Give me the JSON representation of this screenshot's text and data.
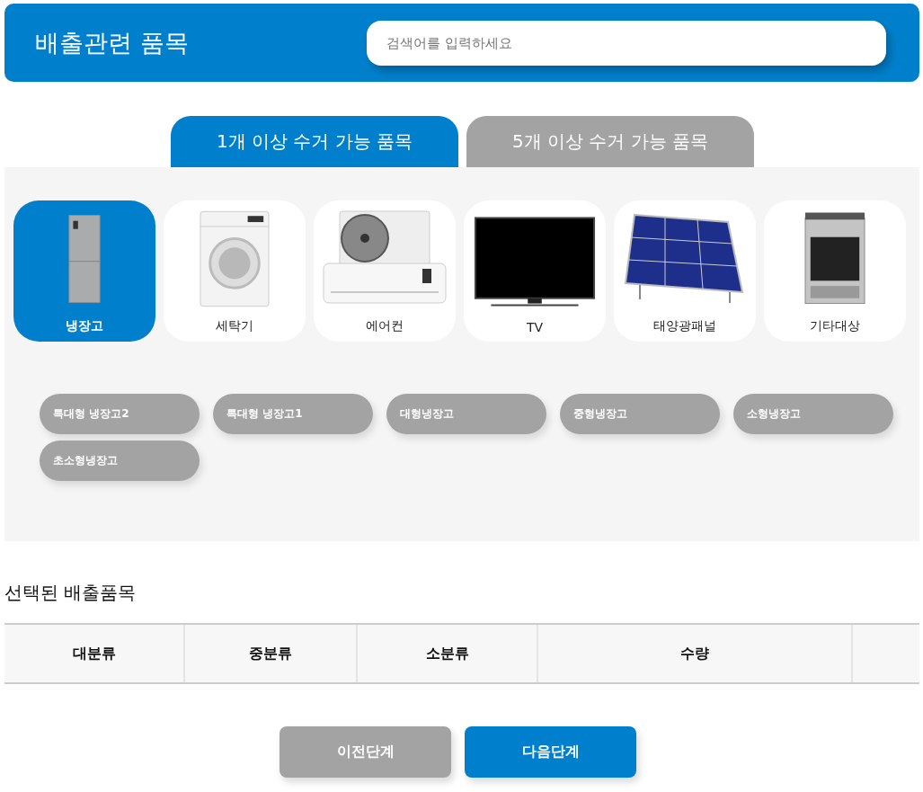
{
  "header": {
    "title": "배출관련 품목",
    "search": {
      "placeholder": "검색어를 입력하세요"
    }
  },
  "tabs": [
    {
      "label": "1개 이상 수거 가능 품목",
      "selected": true
    },
    {
      "label": "5개 이상 수거 가능 품목",
      "selected": false
    }
  ],
  "categories": [
    {
      "label": "냉장고",
      "kind": "fridge",
      "selected": true
    },
    {
      "label": "세탁기",
      "kind": "washer",
      "selected": false
    },
    {
      "label": "에어컨",
      "kind": "aircon",
      "selected": false
    },
    {
      "label": "TV",
      "kind": "tv",
      "selected": false
    },
    {
      "label": "태양광패널",
      "kind": "solar",
      "selected": false
    },
    {
      "label": "기타대상",
      "kind": "oven",
      "selected": false
    }
  ],
  "subcategories": [
    {
      "label": "특대형 냉장고2",
      "selected": false
    },
    {
      "label": "특대형 냉장고1",
      "selected": false
    },
    {
      "label": "대형냉장고",
      "selected": false
    },
    {
      "label": "중형냉장고",
      "selected": false
    },
    {
      "label": "소형냉장고",
      "selected": false
    },
    {
      "label": "초소형냉장고",
      "selected": false
    }
  ],
  "selected_items": {
    "title": "선택된 배출품목",
    "columns": [
      "대분류",
      "중분류",
      "소분류",
      "수량"
    ]
  },
  "buttons": [
    {
      "label": "이전단계",
      "kind": "secondary"
    },
    {
      "label": "다음단계",
      "kind": "primary"
    }
  ]
}
